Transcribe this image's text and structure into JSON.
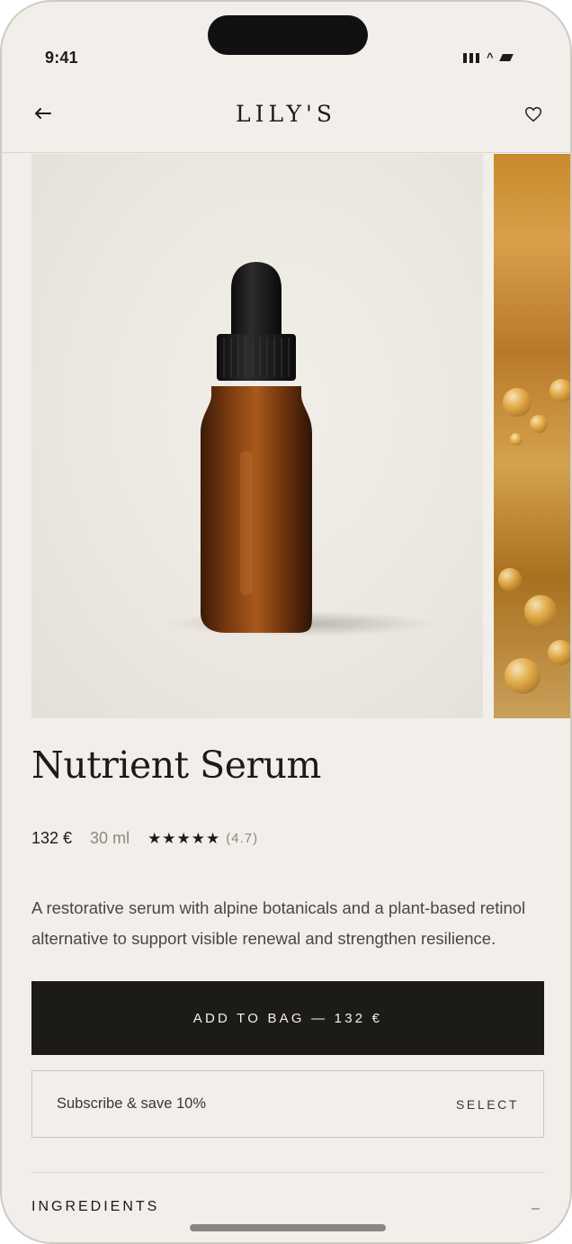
{
  "status_bar": {
    "time": "9:41"
  },
  "nav": {
    "brand": "LILY'S"
  },
  "product": {
    "title": "Nutrient Serum",
    "price": "132 €",
    "size": "30 ml",
    "stars": "★★★★★",
    "rating": "(4.7)",
    "rating_value": 4.7,
    "description": "A restorative serum with alpine botanicals and a plant-based retinol alternative to support visible renewal and strengthen resilience."
  },
  "actions": {
    "add_to_bag": "ADD TO BAG — 132 €",
    "subscribe_label": "Subscribe & save 10%",
    "subscribe_select": "SELECT"
  },
  "sections": {
    "ingredients_label": "INGREDIENTS",
    "ingredients_toggle": "–"
  },
  "colors": {
    "background": "#f2efea",
    "button": "#1c1b18",
    "text": "#1c1b19",
    "muted": "#8c8780"
  },
  "icons": {
    "back": "arrow-left-icon",
    "favorite": "heart-icon",
    "signal": "cellular-signal-icon",
    "wifi": "wifi-icon",
    "battery": "battery-icon"
  }
}
